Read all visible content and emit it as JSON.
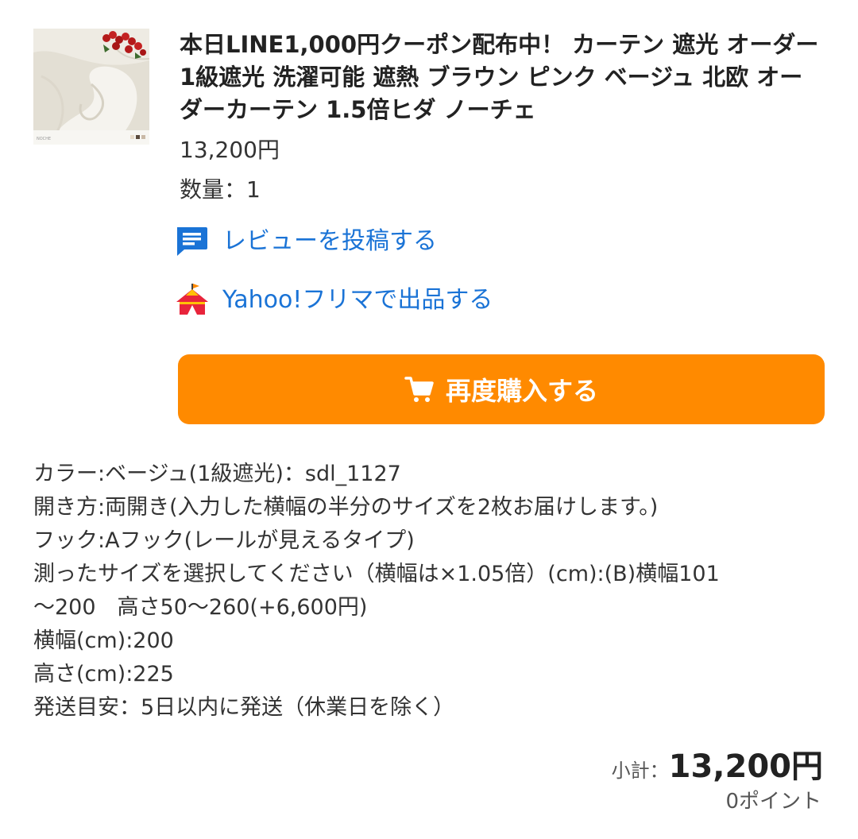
{
  "item": {
    "title": "本日LINE1,000円クーポン配布中！ カーテン 遮光 オーダー 1級遮光 洗濯可能 遮熱 ブラウン ピンク ベージュ 北欧 オーダーカーテン 1.5倍ヒダ ノーチェ",
    "price": "13,200円",
    "quantity": "数量：1",
    "thumbnail_caption": "NOCHE"
  },
  "actions": {
    "review_label": "レビューを投稿する",
    "review_icon": "comment-icon",
    "flea_label": "Yahoo!フリマで出品する",
    "flea_icon": "tent-icon",
    "rebuy_label": "再度購入する",
    "rebuy_icon": "cart-icon"
  },
  "options": [
    "カラー:ベージュ(1級遮光)：sdl_1127",
    "開き方:両開き(入力した横幅の半分のサイズを2枚お届けします。)",
    "フック:Aフック(レールが見えるタイプ)",
    "測ったサイズを選択してください（横幅は×1.05倍）(cm):(B)横幅101",
    "〜200　高さ50〜260(+6,600円)",
    "横幅(cm):200",
    "高さ(cm):225",
    "発送目安：5日以内に発送（休業日を除く）"
  ],
  "summary": {
    "subtotal_label": "小計：",
    "subtotal_value": "13,200円",
    "points": "0ポイント"
  },
  "colors": {
    "link": "#1a73d6",
    "button": "#ff8a00",
    "button_text": "#ffffff"
  }
}
